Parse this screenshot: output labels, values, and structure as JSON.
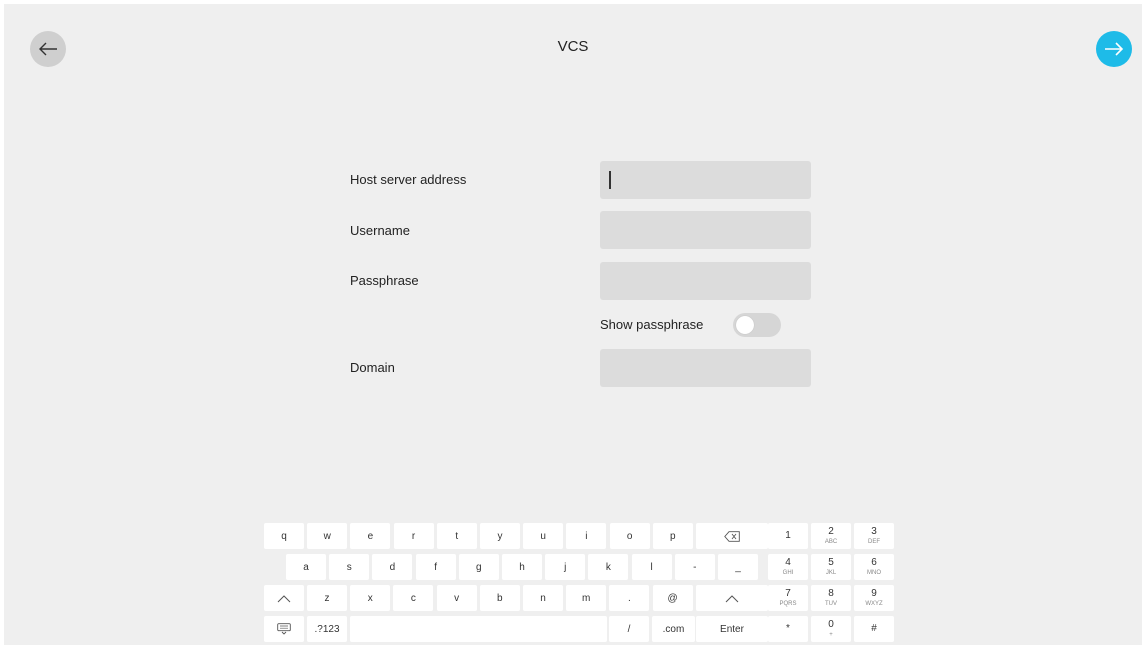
{
  "header": {
    "title": "VCS"
  },
  "form": {
    "host_label": "Host server address",
    "host_value": "",
    "username_label": "Username",
    "username_value": "",
    "passphrase_label": "Passphrase",
    "passphrase_value": "",
    "show_passphrase_label": "Show passphrase",
    "show_passphrase_on": false,
    "domain_label": "Domain",
    "domain_value": ""
  },
  "keyboard": {
    "row1": [
      "q",
      "w",
      "e",
      "r",
      "t",
      "y",
      "u",
      "i",
      "o",
      "p"
    ],
    "row2": [
      "a",
      "s",
      "d",
      "f",
      "g",
      "h",
      "j",
      "k",
      "l",
      "-",
      "_"
    ],
    "row3": [
      "z",
      "x",
      "c",
      "v",
      "b",
      "n",
      "m",
      ".",
      "@"
    ],
    "symbols_label": ".?123",
    "slash_label": "/",
    "dotcom_label": ".com",
    "enter_label": "Enter",
    "numpad": [
      {
        "d": "1",
        "s": ""
      },
      {
        "d": "2",
        "s": "ABC"
      },
      {
        "d": "3",
        "s": "DEF"
      },
      {
        "d": "4",
        "s": "GHI"
      },
      {
        "d": "5",
        "s": "JKL"
      },
      {
        "d": "6",
        "s": "MNO"
      },
      {
        "d": "7",
        "s": "PQRS"
      },
      {
        "d": "8",
        "s": "TUV"
      },
      {
        "d": "9",
        "s": "WXYZ"
      },
      {
        "d": "*",
        "s": ""
      },
      {
        "d": "0",
        "s": "+"
      },
      {
        "d": "#",
        "s": ""
      }
    ]
  },
  "colors": {
    "accent": "#1ebbe8",
    "background": "#efefef",
    "field": "#dcdcdc"
  },
  "icons": {
    "back": "arrow-left-icon",
    "next": "arrow-right-icon",
    "backspace": "backspace-icon",
    "shift": "shift-icon",
    "keyboard_hide": "keyboard-hide-icon"
  }
}
